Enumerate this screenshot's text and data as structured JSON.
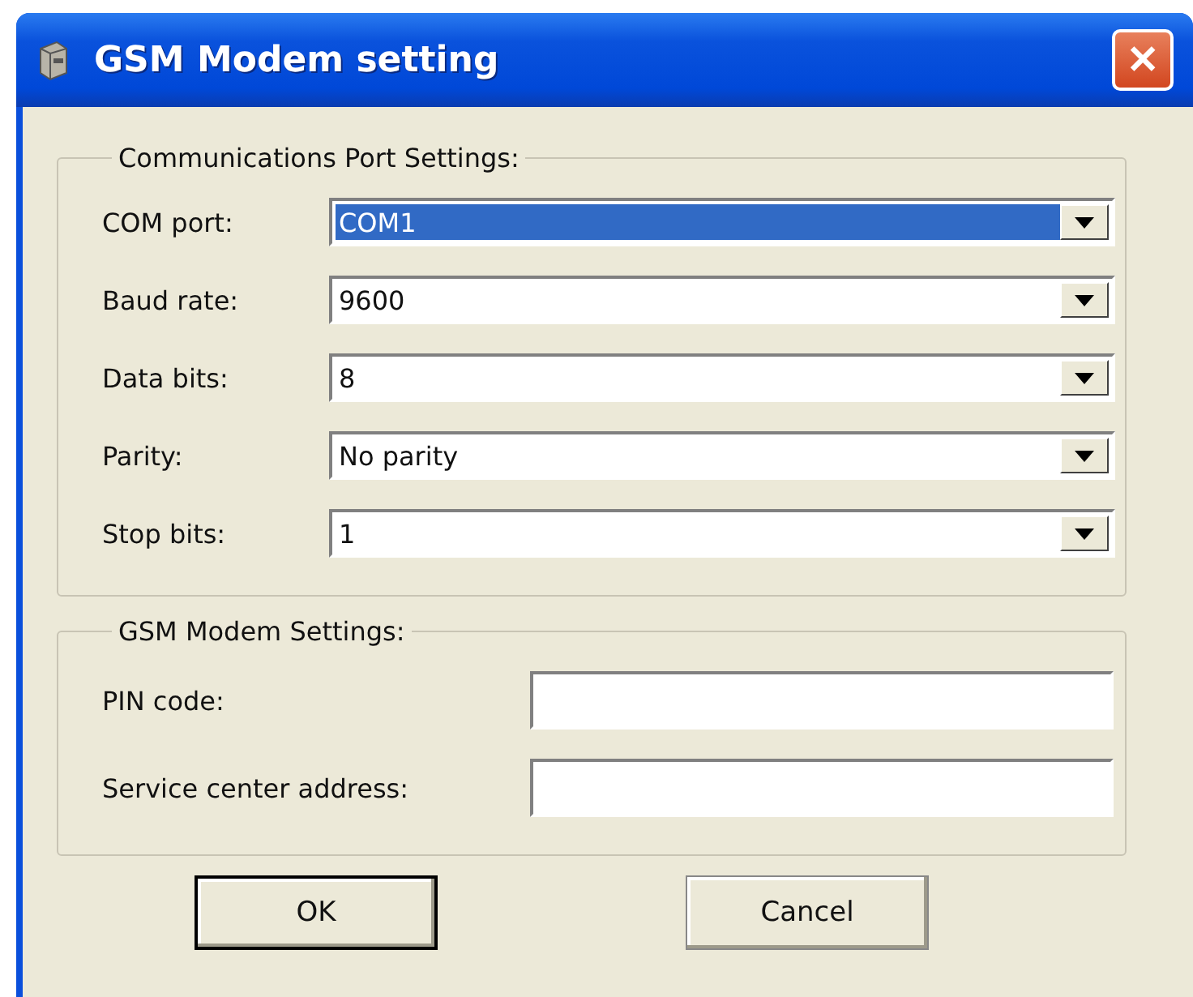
{
  "window": {
    "title": "GSM Modem setting",
    "close": "✕"
  },
  "port_settings": {
    "title": "Communications Port Settings:",
    "fields": [
      {
        "label": "COM port:",
        "value": "COM1",
        "focused": true
      },
      {
        "label": "Baud rate:",
        "value": "9600",
        "focused": false
      },
      {
        "label": "Data bits:",
        "value": "8",
        "focused": false
      },
      {
        "label": "Parity:",
        "value": "No parity",
        "focused": false
      },
      {
        "label": "Stop bits:",
        "value": "1",
        "focused": false
      }
    ]
  },
  "modem_settings": {
    "title": "GSM Modem Settings:",
    "fields": [
      {
        "label": "PIN code:"
      },
      {
        "label": "Service center address:"
      }
    ]
  },
  "buttons": [
    {
      "label": "OK",
      "default": true
    },
    {
      "label": "Cancel",
      "default": false
    }
  ]
}
